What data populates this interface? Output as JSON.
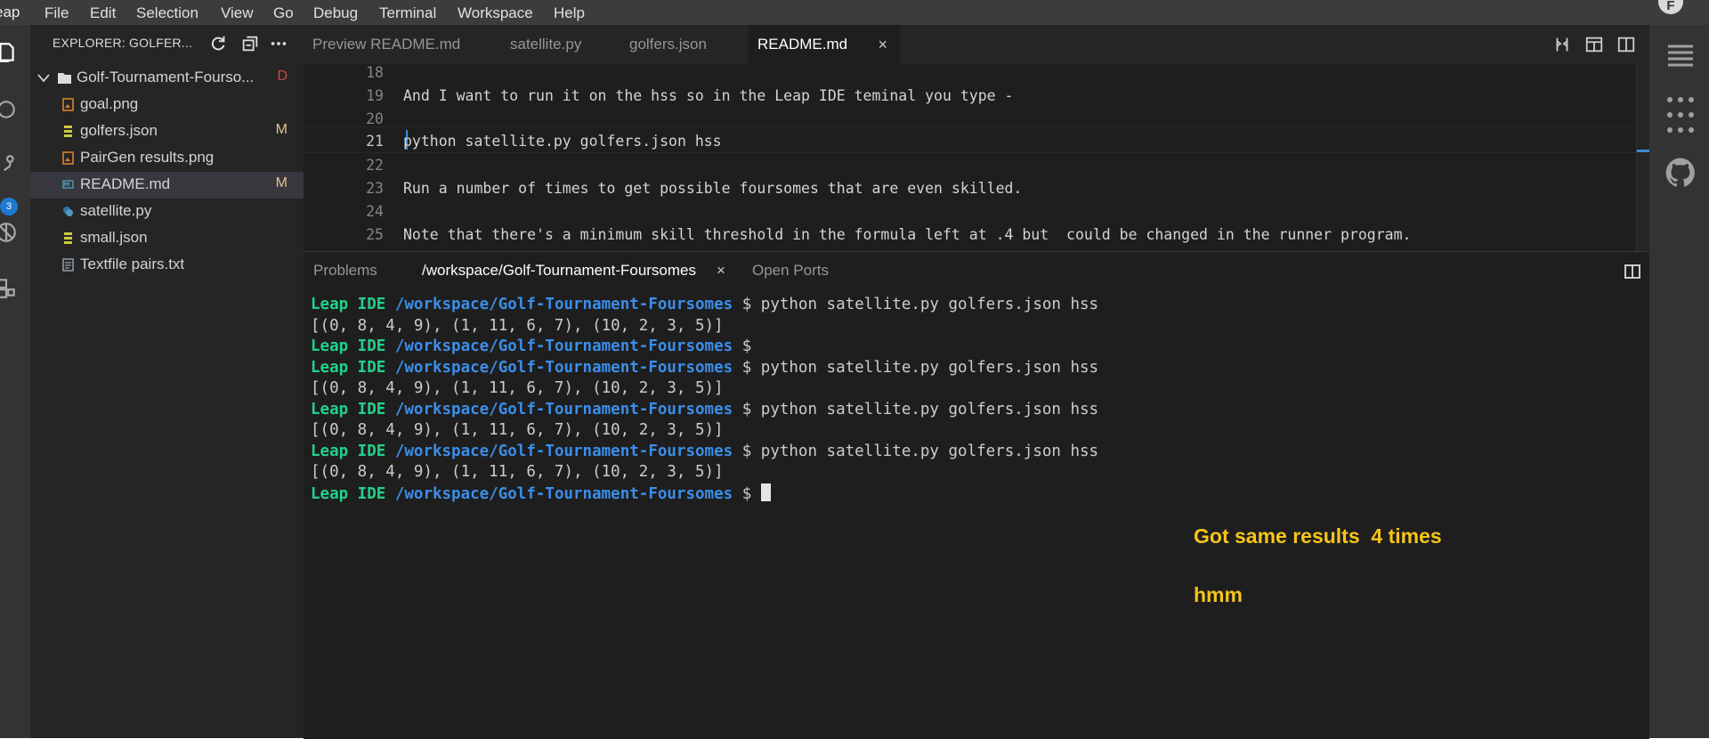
{
  "menubar": {
    "logo": "eap",
    "items": [
      "File",
      "Edit",
      "Selection",
      "View",
      "Go",
      "Debug",
      "Terminal",
      "Workspace",
      "Help"
    ],
    "account_initial": "F"
  },
  "activity": {
    "icons": [
      "files-icon",
      "search-icon",
      "source-control-icon",
      "debug-icon",
      "extensions-icon"
    ],
    "scm_badge": "3"
  },
  "sidebar": {
    "title": "EXPLORER: GOLFER...",
    "folder": {
      "label": "Golf-Tournament-Fourso...",
      "badge": "D"
    },
    "files": [
      {
        "label": "goal.png",
        "badge": "",
        "icon": "image-file-icon"
      },
      {
        "label": "golfers.json",
        "badge": "M",
        "icon": "json-file-icon"
      },
      {
        "label": "PairGen results.png",
        "badge": "",
        "icon": "image-file-icon"
      },
      {
        "label": "README.md",
        "badge": "M",
        "icon": "markdown-file-icon"
      },
      {
        "label": "satellite.py",
        "badge": "",
        "icon": "python-file-icon"
      },
      {
        "label": "small.json",
        "badge": "",
        "icon": "json-file-icon"
      },
      {
        "label": "Textfile pairs.txt",
        "badge": "",
        "icon": "text-file-icon"
      }
    ]
  },
  "tabs": {
    "items": [
      "Preview README.md",
      "satellite.py",
      "golfers.json",
      "README.md"
    ],
    "active_close": "×"
  },
  "editor": {
    "lines": [
      {
        "num": "18",
        "text": ""
      },
      {
        "num": "19",
        "text": "And I want to run it on the hss so in the Leap IDE teminal you type -"
      },
      {
        "num": "20",
        "text": ""
      },
      {
        "num": "21",
        "text": "python satellite.py golfers.json hss"
      },
      {
        "num": "22",
        "text": ""
      },
      {
        "num": "23",
        "text": "Run a number of times to get possible foursomes that are even skilled."
      },
      {
        "num": "24",
        "text": ""
      },
      {
        "num": "25",
        "text": "Note that there's a minimum skill threshold in the formula left at .4 but  could be changed in the runner program."
      }
    ]
  },
  "panel": {
    "tabs": [
      "Problems",
      "/workspace/Golf-Tournament-Foursomes",
      "Open Ports"
    ],
    "active_close": "×"
  },
  "terminal": {
    "host": "Leap IDE",
    "path": "/workspace/Golf-Tournament-Foursomes",
    "prompt": "$",
    "command": "python satellite.py golfers.json hss",
    "output": "[(0, 8, 4, 9), (1, 11, 6, 7), (10, 2, 3, 5)]"
  },
  "annotations": {
    "line1": "Got same results  4 times",
    "line2": "hmm"
  },
  "colors": {
    "terminal_host": "#23d18b",
    "terminal_path": "#3b8eea",
    "annotation": "#f5c518",
    "badge_modified": "#e2c08d",
    "badge_deleted": "#c74e39"
  }
}
